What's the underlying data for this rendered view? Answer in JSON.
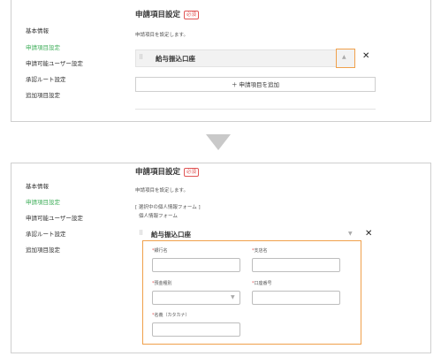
{
  "sidebar": {
    "items": [
      {
        "label": "基本情報"
      },
      {
        "label": "申請項目設定"
      },
      {
        "label": "申請可能ユーザー設定"
      },
      {
        "label": "承認ルート設定"
      },
      {
        "label": "追加項目設定"
      }
    ]
  },
  "section": {
    "title": "申請項目設定",
    "required_badge": "必須",
    "description": "申請項目を設定します。"
  },
  "item": {
    "drag_icon": "⠿",
    "label": "給与振込口座",
    "caret": "▲",
    "caret_down": "▼",
    "remove": "✕"
  },
  "add_button": {
    "label": "＋ 申請項目を追加"
  },
  "selected_form": {
    "caption": "[ 選択中の個人情報フォーム ]",
    "name": "個人情報フォーム"
  },
  "form_fields": {
    "bank_name": {
      "label": "銀行名",
      "required": "*"
    },
    "branch_name": {
      "label": "支店名",
      "required": "*"
    },
    "account_type": {
      "label": "預金種別",
      "required": "*"
    },
    "account_number": {
      "label": "口座番号",
      "required": "*"
    },
    "holder_name": {
      "label": "名義（カタカナ）",
      "required": "*"
    }
  },
  "colors": {
    "accent_green": "#3fae5a",
    "highlight_orange": "#f0a04b",
    "required_red": "#e05555"
  }
}
